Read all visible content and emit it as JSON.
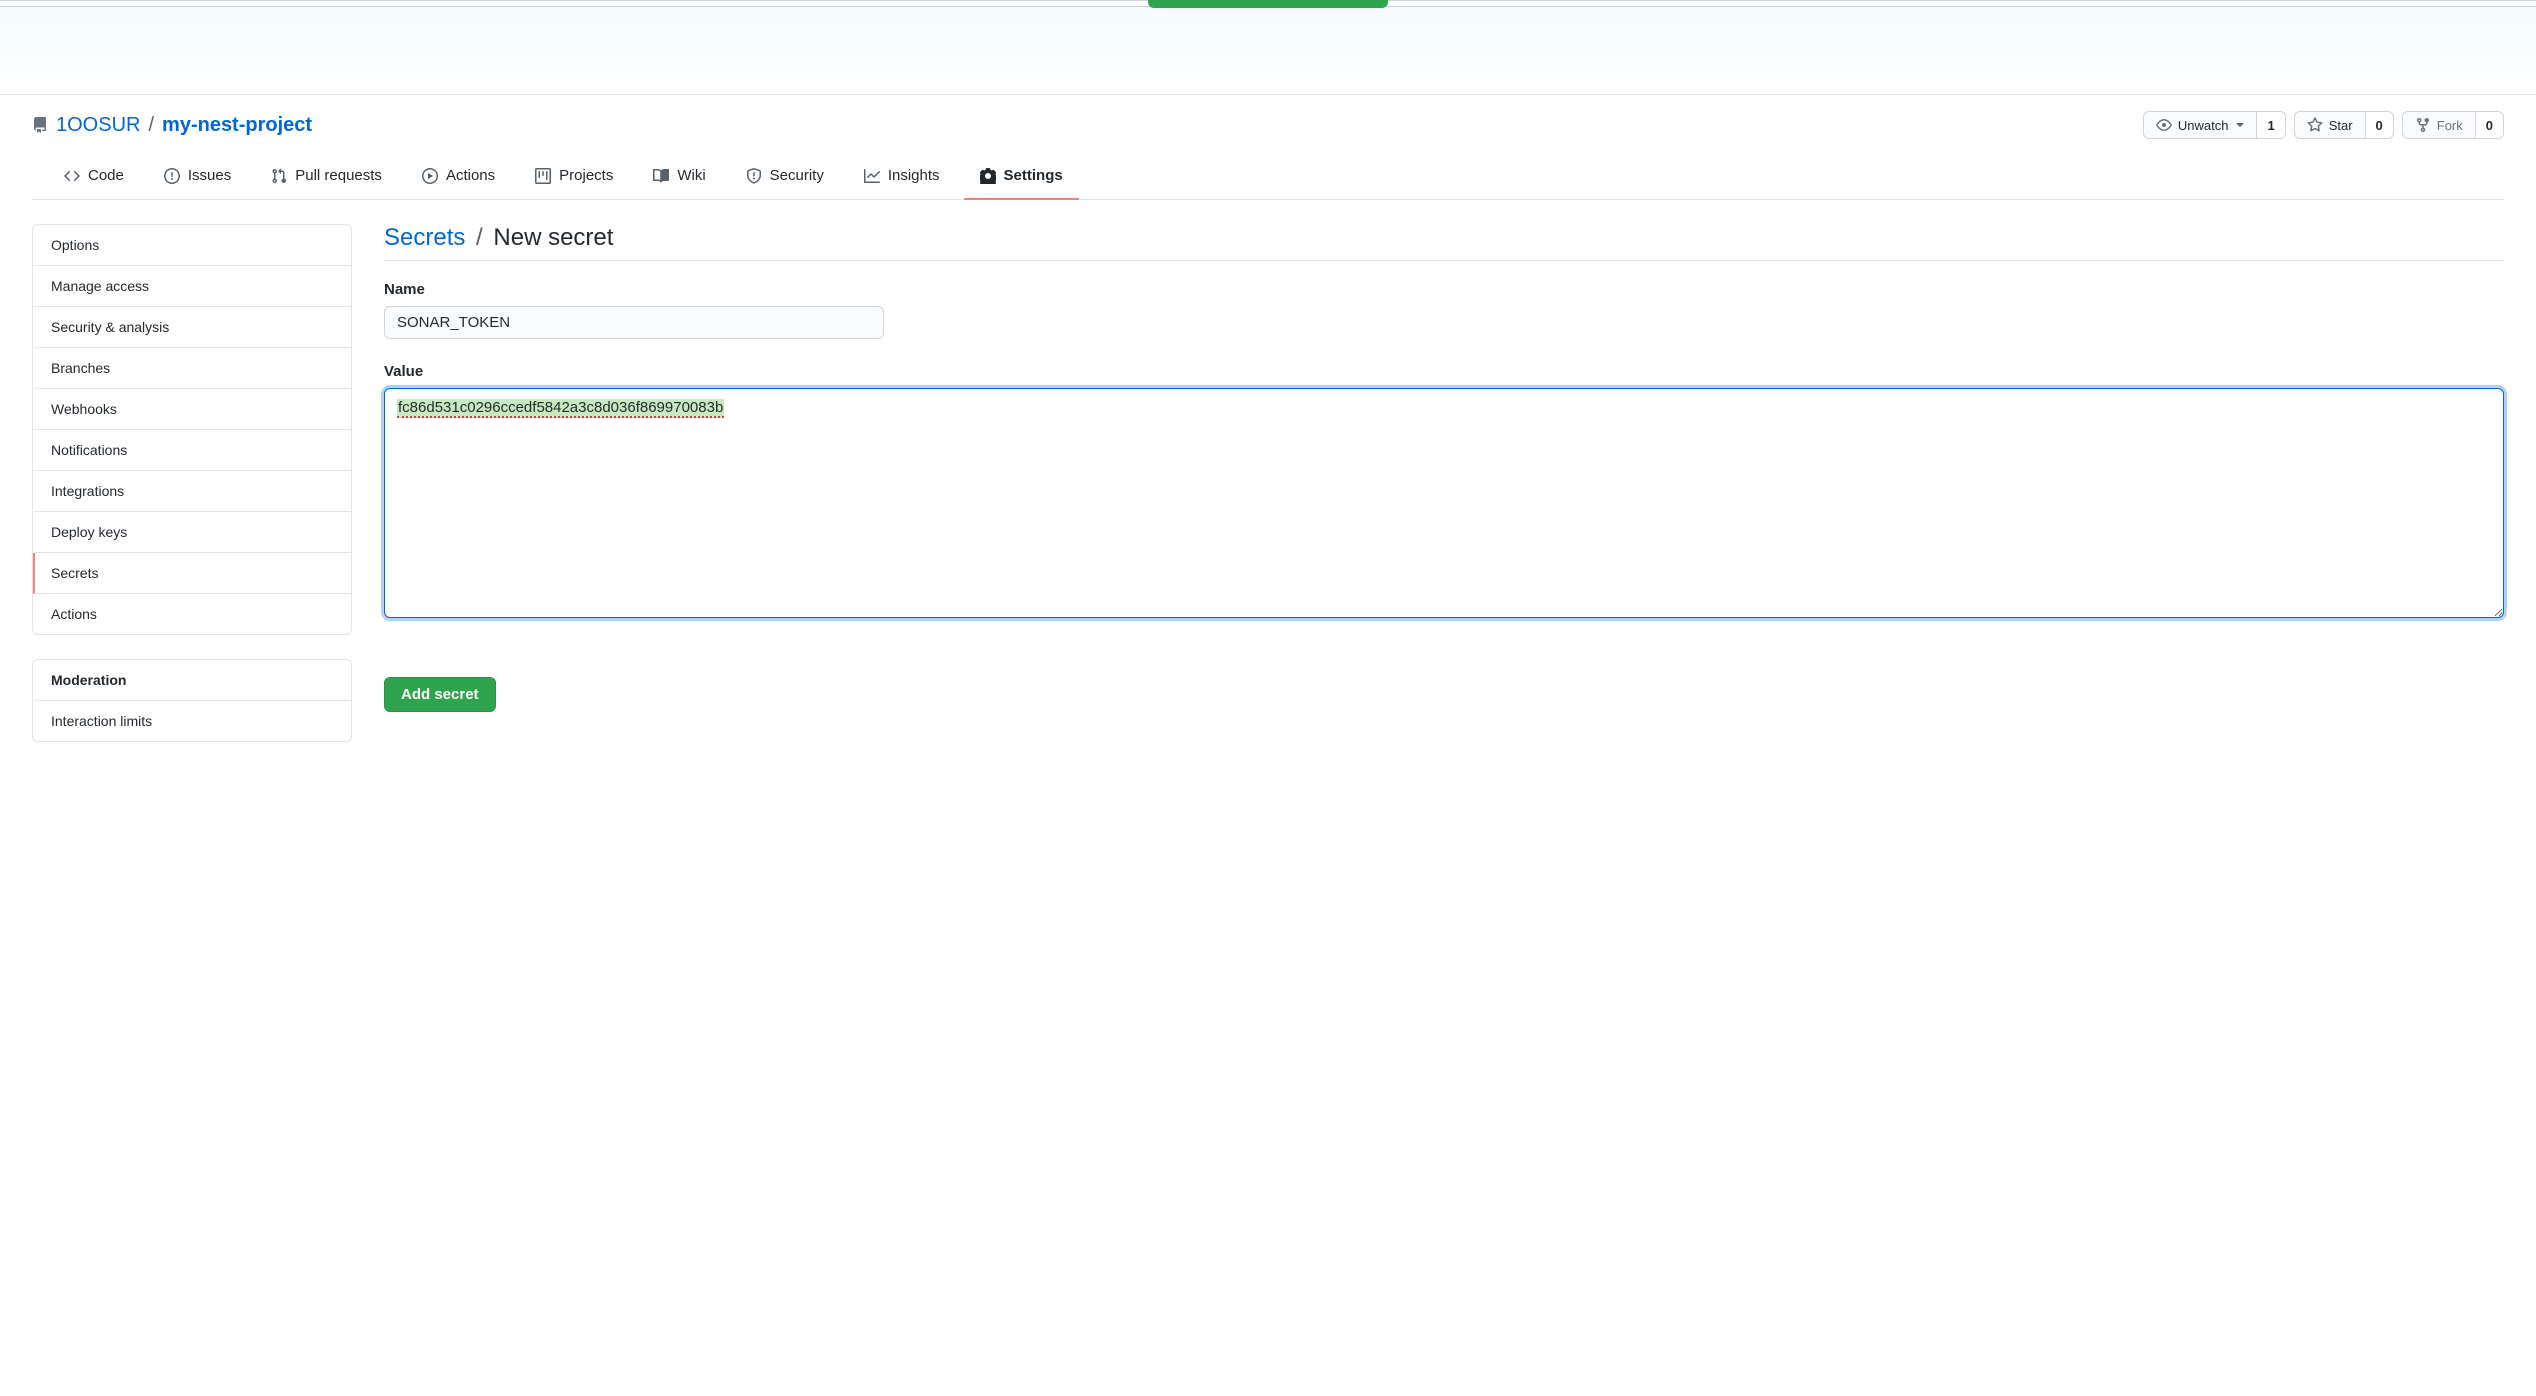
{
  "repo": {
    "owner": "1OOSUR",
    "name": "my-nest-project"
  },
  "actions": {
    "unwatch_label": "Unwatch",
    "unwatch_count": "1",
    "star_label": "Star",
    "star_count": "0",
    "fork_label": "Fork",
    "fork_count": "0"
  },
  "tabs": {
    "code": "Code",
    "issues": "Issues",
    "pulls": "Pull requests",
    "actions": "Actions",
    "projects": "Projects",
    "wiki": "Wiki",
    "security": "Security",
    "insights": "Insights",
    "settings": "Settings"
  },
  "sidebar1": [
    {
      "label": "Options",
      "active": false
    },
    {
      "label": "Manage access",
      "active": false
    },
    {
      "label": "Security & analysis",
      "active": false
    },
    {
      "label": "Branches",
      "active": false
    },
    {
      "label": "Webhooks",
      "active": false
    },
    {
      "label": "Notifications",
      "active": false
    },
    {
      "label": "Integrations",
      "active": false
    },
    {
      "label": "Deploy keys",
      "active": false
    },
    {
      "label": "Secrets",
      "active": true
    },
    {
      "label": "Actions",
      "active": false
    }
  ],
  "sidebar2_heading": "Moderation",
  "sidebar2": [
    {
      "label": "Interaction limits"
    }
  ],
  "page": {
    "crumb_root": "Secrets",
    "crumb_current": "New secret",
    "name_label": "Name",
    "name_value": "SONAR_TOKEN",
    "value_label": "Value",
    "value_value": "fc86d531c0296ccedf5842a3c8d036f869970083b",
    "submit_label": "Add secret"
  }
}
